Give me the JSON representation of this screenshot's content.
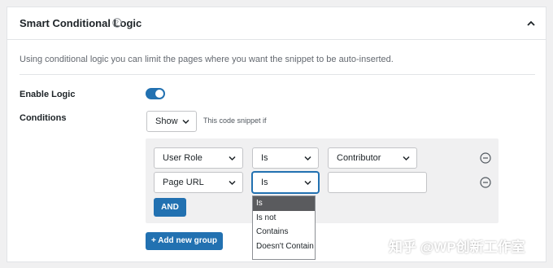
{
  "panel": {
    "title": "Smart Conditional Logic",
    "description": "Using conditional logic you can limit the pages where you want the snippet to be auto-inserted."
  },
  "enable_logic": {
    "label": "Enable Logic",
    "enabled": true
  },
  "conditions": {
    "label": "Conditions",
    "mode_value": "Show",
    "hint": "This code snippet if"
  },
  "rules": [
    {
      "field": "User Role",
      "operator": "Is",
      "value": "Contributor"
    },
    {
      "field": "Page URL",
      "operator": "Is",
      "value": ""
    }
  ],
  "and_button": "AND",
  "add_group_button": "+ Add new group",
  "operator_options": [
    "Is",
    "Is not",
    "Contains",
    "Doesn't Contain"
  ],
  "operator_selected_index": 0,
  "watermark": "知乎 @WP创新工作室",
  "colors": {
    "accent": "#2271b1",
    "border": "#c3c4c7",
    "panel_bg": "#ffffff",
    "page_bg": "#f0f0f1",
    "group_bg": "#f0f0f1",
    "dropdown_selected": "#5a5b5e"
  }
}
